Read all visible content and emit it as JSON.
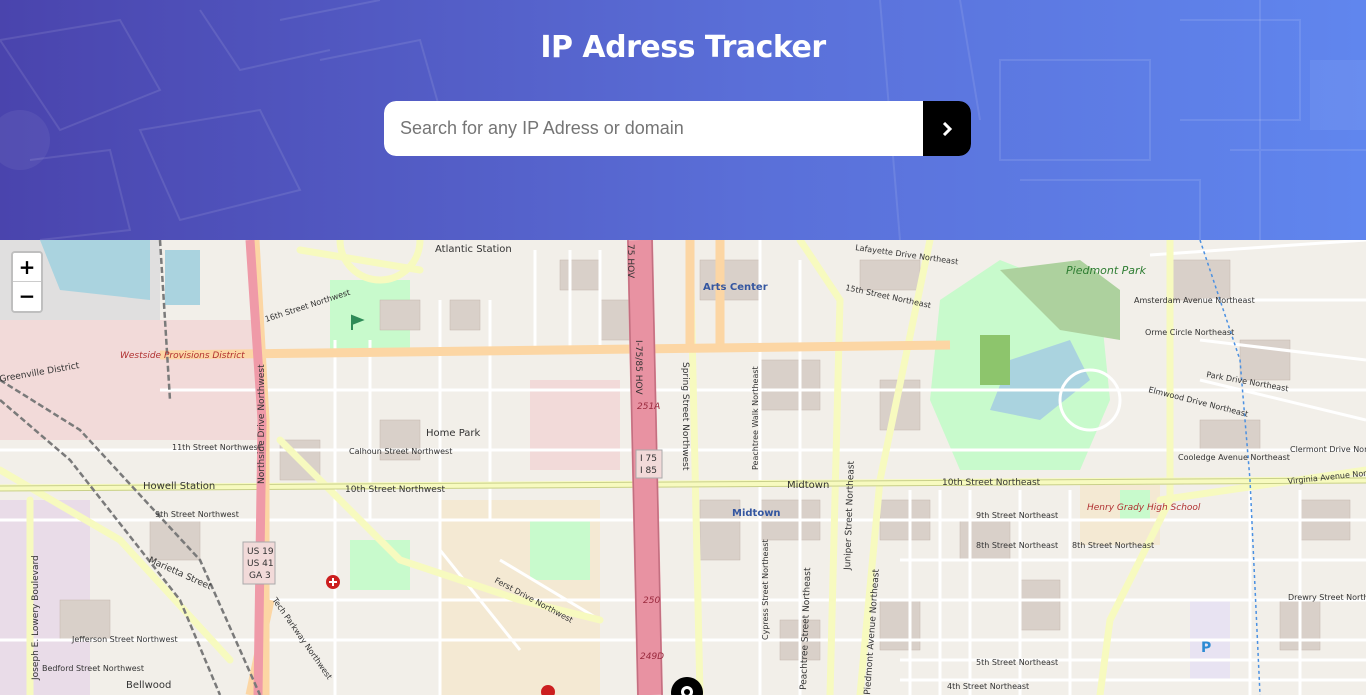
{
  "header": {
    "title": "IP Adress Tracker"
  },
  "search": {
    "placeholder": "Search for any IP Adress or domain",
    "value": "",
    "submit_icon": "chevron-right-icon"
  },
  "map": {
    "zoom_in_label": "+",
    "zoom_out_label": "−",
    "marker_icon": "location-pin-icon",
    "labels": {
      "atlantic_station": "Atlantic Station",
      "arts_center": "Arts Center",
      "lafayette": "Lafayette Drive Northeast",
      "piedmont_park": "Piedmont Park",
      "fifteenth": "15th Street Northeast",
      "amsterdam": "Amsterdam Avenue Northeast",
      "sixteenth": "16th Street Northwest",
      "westside": "Westside Provisions District",
      "greenville": "Greenville District",
      "northside": "Northside Drive Northwest",
      "home_park": "Home Park",
      "eleventh": "11th Street Northwest",
      "calhoun": "Calhoun Street Northwest",
      "howell": "Howell Station",
      "tenth_nw": "10th Street Northwest",
      "tenth_ne": "10th Street Northeast",
      "midtown": "Midtown",
      "midtown_station": "Midtown",
      "ninth_nw": "9th Street Northwest",
      "ninth_ne": "9th Street Northeast",
      "eighth_ne": "8th Street Northeast",
      "eighth_ne2": "8th Street Northeast",
      "marietta": "Marietta Street",
      "first_drive": "Ferst Drive Northwest",
      "tech_parkway": "Tech Parkway Northwest",
      "jefferson": "Jefferson Street Northwest",
      "bedford": "Bedford Street Northwest",
      "bellwood": "Bellwood",
      "lowery": "Joseph E. Lowery Boulevard",
      "spring": "Spring Street Northwest",
      "peachtree_walk": "Peachtree Walk Northeast",
      "juniper": "Juniper Street Northeast",
      "peachtree_st": "Peachtree Street Northeast",
      "cypress": "Cypress Street Northeast",
      "piedmont_ave": "Piedmont Avenue Northeast",
      "henry_grady": "Henry Grady High School",
      "coolidge": "Cooledge Avenue Northeast",
      "virginia": "Virginia Avenue Northeast",
      "ormewood": "Orme Circle Northeast",
      "park_drive": "Park Drive Northeast",
      "elmwood": "Elmwood Drive Northeast",
      "clermont": "Clermont Drive Northeast",
      "drewry": "Drewry Street Northeast",
      "fifth_ne": "5th Street Northeast",
      "fourth_ne": "4th Street Northeast",
      "i75_85_hov": "I-75/85 HOV",
      "i75_hov": "75 HOV",
      "exit_251a": "251A",
      "exit_250": "250",
      "exit_249d": "249D",
      "shield_i75": "I 75",
      "shield_i85": "I 85",
      "shield_us19": "US 19",
      "shield_us41": "US 41",
      "shield_ga3": "GA 3",
      "parking": "P"
    }
  },
  "colors": {
    "header_start": "#4a44ad",
    "header_end": "#6086ee",
    "button_bg": "#000000",
    "map_land": "#f2efe9",
    "park_green": "#c8facc",
    "water": "#aad3df",
    "motorway": "#e892a2",
    "primary_road": "#fcd6a4",
    "secondary_road": "#f7fabf"
  }
}
